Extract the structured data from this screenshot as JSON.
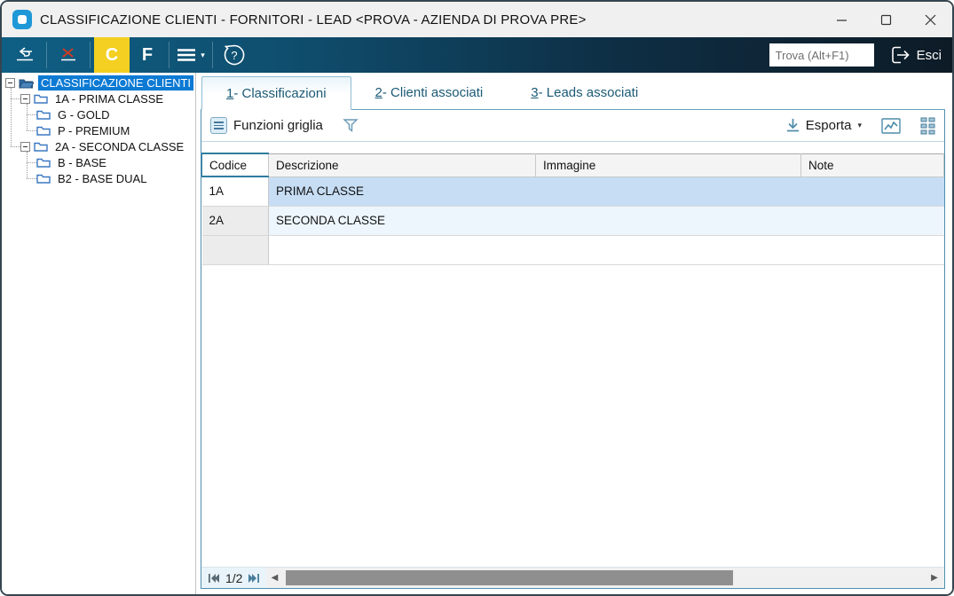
{
  "window": {
    "title": "CLASSIFICAZIONE CLIENTI - FORNITORI - LEAD <PROVA - AZIENDA DI PROVA PRE>"
  },
  "toolbar": {
    "c_label": "C",
    "f_label": "F",
    "hamburger_caret": "▾",
    "help_glyph": "?",
    "search_placeholder": "Trova (Alt+F1)",
    "exit_label": "Esci"
  },
  "tree": {
    "items": [
      {
        "label": "CLASSIFICAZIONE CLIENTI",
        "level": 0,
        "selected": true
      },
      {
        "label": "1A - PRIMA CLASSE",
        "level": 1
      },
      {
        "label": "G - GOLD",
        "level": 2
      },
      {
        "label": "P - PREMIUM",
        "level": 2
      },
      {
        "label": "2A - SECONDA CLASSE",
        "level": 1
      },
      {
        "label": "B - BASE",
        "level": 2
      },
      {
        "label": "B2 - BASE DUAL",
        "level": 2
      }
    ]
  },
  "tabs": [
    {
      "number": "1",
      "rest": "- Classificazioni",
      "active": true
    },
    {
      "number": "2",
      "rest": " - Clienti associati",
      "active": false
    },
    {
      "number": "3",
      "rest": " - Leads associati",
      "active": false
    }
  ],
  "grid_toolbar": {
    "funzioni_label": "Funzioni griglia",
    "esporta_label": "Esporta",
    "esporta_caret": "▾"
  },
  "table": {
    "columns": [
      "Codice",
      "Descrizione",
      "Immagine",
      "Note"
    ],
    "rows": [
      {
        "codice": "1A",
        "descrizione": "PRIMA CLASSE",
        "immagine": "",
        "note": ""
      },
      {
        "codice": "2A",
        "descrizione": "SECONDA CLASSE",
        "immagine": "",
        "note": ""
      }
    ]
  },
  "pager": {
    "page_label": "1/2",
    "left_arrow": "◀",
    "right_arrow": "▶"
  },
  "colors": {
    "toolbar_left": "#0f5f84",
    "toolbar_right": "#0d1b26",
    "c_button_bg": "#f3d021",
    "delete_x": "#cd3a23",
    "tree_selection": "#0d7ad4",
    "tab_text": "#1b5a75",
    "row_selected": "#c6ddf4",
    "row_alt": "#edf6fd",
    "content_border": "#4f8fae",
    "column_accent": "#2e7d9e"
  }
}
